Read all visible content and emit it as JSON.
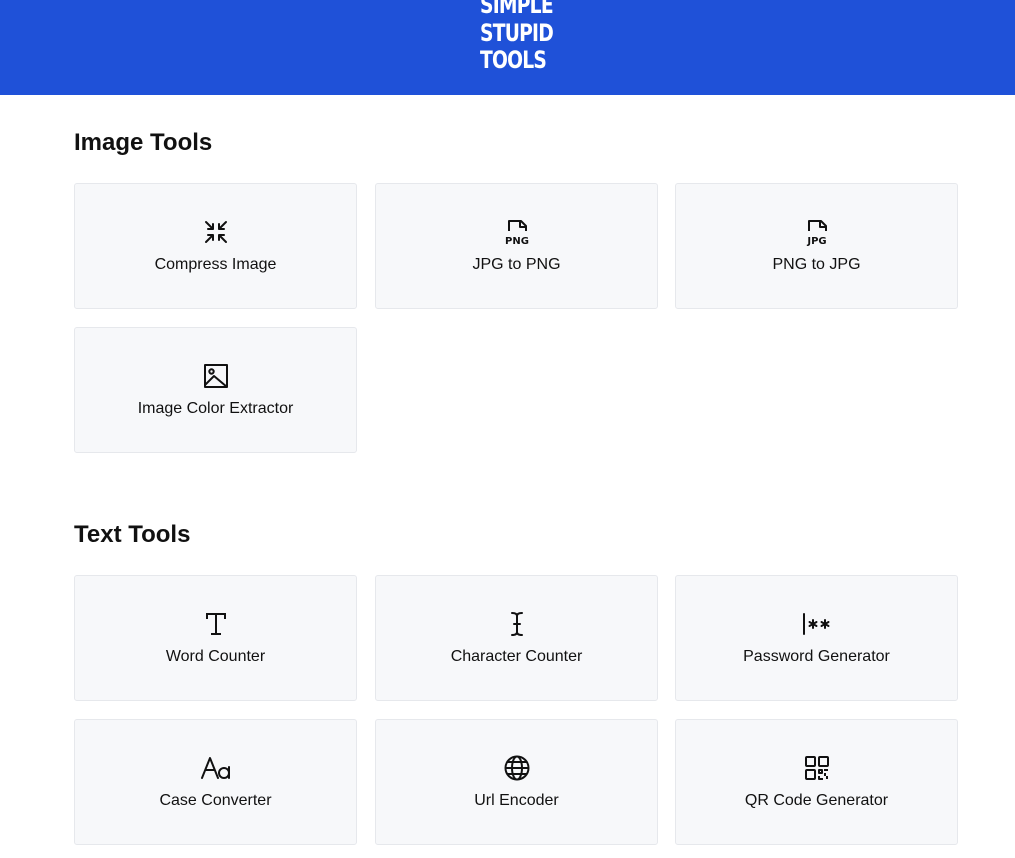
{
  "header": {
    "logo_lines": [
      "SIMPLE",
      "STUPID",
      "TOOLS"
    ],
    "background_color": "#1f51d8"
  },
  "sections": [
    {
      "title": "Image Tools",
      "tools": [
        {
          "label": "Compress Image",
          "icon": "compress-arrows-icon"
        },
        {
          "label": "JPG to PNG",
          "icon": "png-file-icon"
        },
        {
          "label": "PNG to JPG",
          "icon": "jpg-file-icon"
        },
        {
          "label": "Image Color Extractor",
          "icon": "image-icon"
        }
      ]
    },
    {
      "title": "Text Tools",
      "tools": [
        {
          "label": "Word Counter",
          "icon": "text-t-icon"
        },
        {
          "label": "Character Counter",
          "icon": "text-cursor-icon"
        },
        {
          "label": "Password Generator",
          "icon": "password-asterisks-icon"
        },
        {
          "label": "Case Converter",
          "icon": "case-aa-icon"
        },
        {
          "label": "Url Encoder",
          "icon": "globe-icon"
        },
        {
          "label": "QR Code Generator",
          "icon": "qr-code-icon"
        }
      ]
    }
  ]
}
